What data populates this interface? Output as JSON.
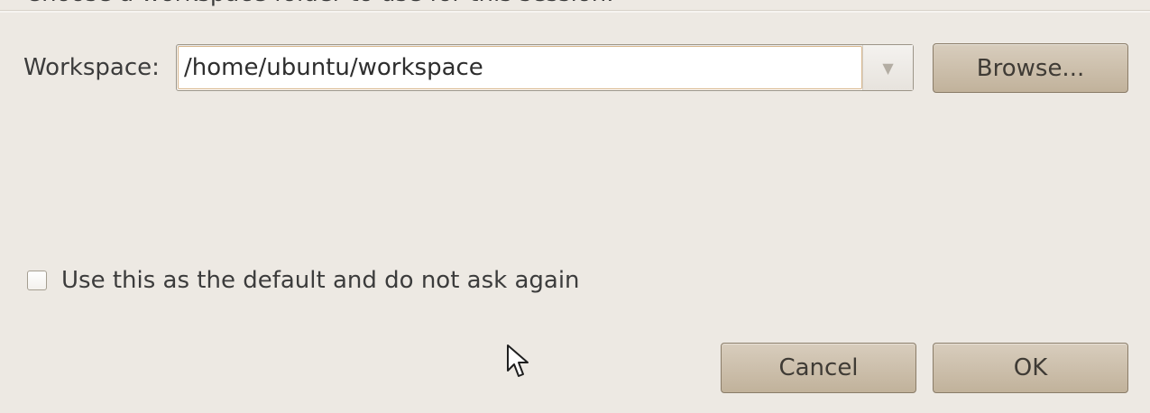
{
  "dialog": {
    "instruction": "Choose a workspace folder to use for this session."
  },
  "workspace": {
    "label": "Workspace:",
    "value": "/home/ubuntu/workspace",
    "dropdown_icon": "triangle-down-icon"
  },
  "browse": {
    "label": "Browse..."
  },
  "default_option": {
    "label": "Use this as the default and do not ask again",
    "checked": false
  },
  "buttons": {
    "cancel": "Cancel",
    "ok": "OK"
  },
  "colors": {
    "background": "#ede9e3",
    "button": "#c8baa5",
    "input_background": "#ffffff"
  },
  "icons": {
    "cursor": "mouse-pointer-icon"
  }
}
